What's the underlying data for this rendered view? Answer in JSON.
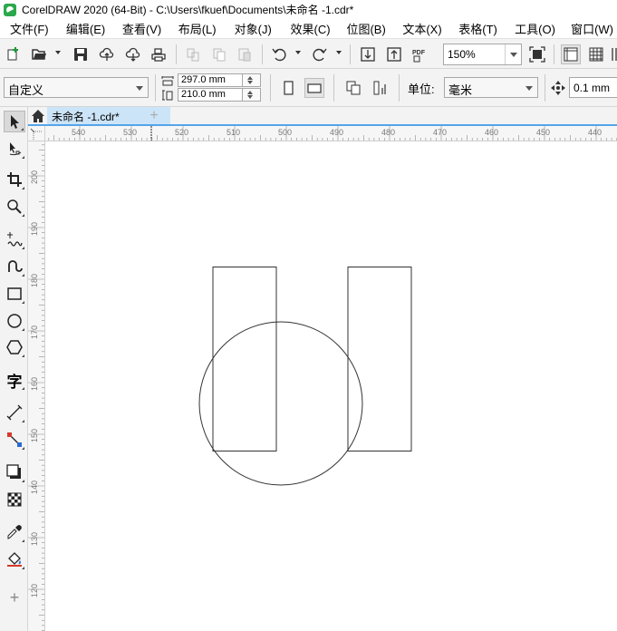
{
  "window": {
    "title": "CorelDRAW 2020 (64-Bit) - C:\\Users\\fkuef\\Documents\\未命名 -1.cdr*"
  },
  "menu": {
    "items": [
      "文件(F)",
      "编辑(E)",
      "查看(V)",
      "布局(L)",
      "对象(J)",
      "效果(C)",
      "位图(B)",
      "文本(X)",
      "表格(T)",
      "工具(O)",
      "窗口(W)"
    ]
  },
  "toolbar": {
    "zoom_value": "150%",
    "pdf_label": "PDF"
  },
  "propertybar": {
    "page_preset": "自定义",
    "page_width": "297.0 mm",
    "page_height": "210.0 mm",
    "units_label": "单位:",
    "units_value": "毫米",
    "nudge_value": "0.1 mm"
  },
  "tabs": {
    "document_tab": "未命名 -1.cdr*",
    "new_tab_glyph": "+"
  },
  "toolbox": {
    "text_tool_glyph": "字",
    "add_tool_glyph": "+"
  },
  "rulers": {
    "horizontal_labels": [
      "540",
      "530",
      "520",
      "510",
      "500",
      "490",
      "480",
      "470",
      "460",
      "450",
      "440"
    ],
    "vertical_labels": [
      "200",
      "190",
      "180",
      "170",
      "160",
      "150",
      "140",
      "130",
      "120"
    ]
  }
}
